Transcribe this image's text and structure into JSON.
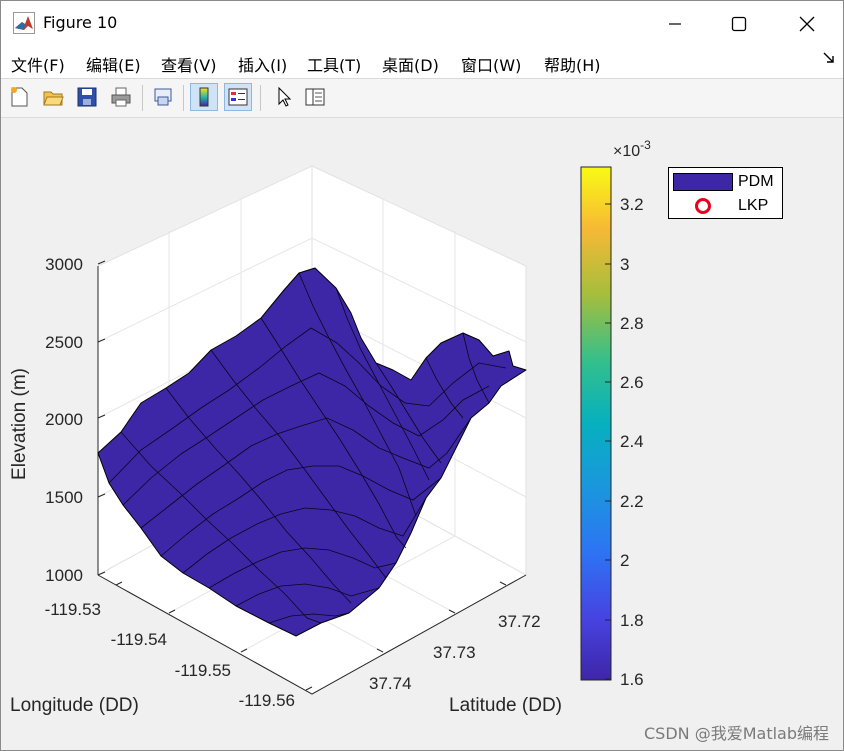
{
  "window": {
    "title": "Figure 10"
  },
  "menu": [
    "文件(F)",
    "编辑(E)",
    "查看(V)",
    "插入(I)",
    "工具(T)",
    "桌面(D)",
    "窗口(W)",
    "帮助(H)"
  ],
  "toolbar_icons": [
    "new-figure-icon",
    "open-file-icon",
    "save-icon",
    "print-icon",
    "link-plot-icon",
    "insert-colorbar-icon",
    "insert-legend-icon",
    "pointer-icon",
    "property-inspector-icon"
  ],
  "plot": {
    "zlabel": "Elevation (m)",
    "xlabel": "Longitude (DD)",
    "ylabel": "Latitude (DD)",
    "z_ticks": [
      "3000",
      "2500",
      "2000",
      "1500",
      "1000"
    ],
    "x_ticks": [
      "-119.53",
      "-119.54",
      "-119.55",
      "-119.56"
    ],
    "y_ticks": [
      "37.72",
      "37.73",
      "37.74"
    ],
    "surface_color": "#3d27a7"
  },
  "colorbar": {
    "multiplier": "×10",
    "exponent": "-3",
    "ticks": [
      "3.2",
      "3",
      "2.8",
      "2.6",
      "2.4",
      "2.2",
      "2",
      "1.8",
      "1.6"
    ]
  },
  "legend": {
    "items": [
      "PDM",
      "LKP"
    ]
  },
  "watermark": "CSDN @我爱Matlab编程"
}
